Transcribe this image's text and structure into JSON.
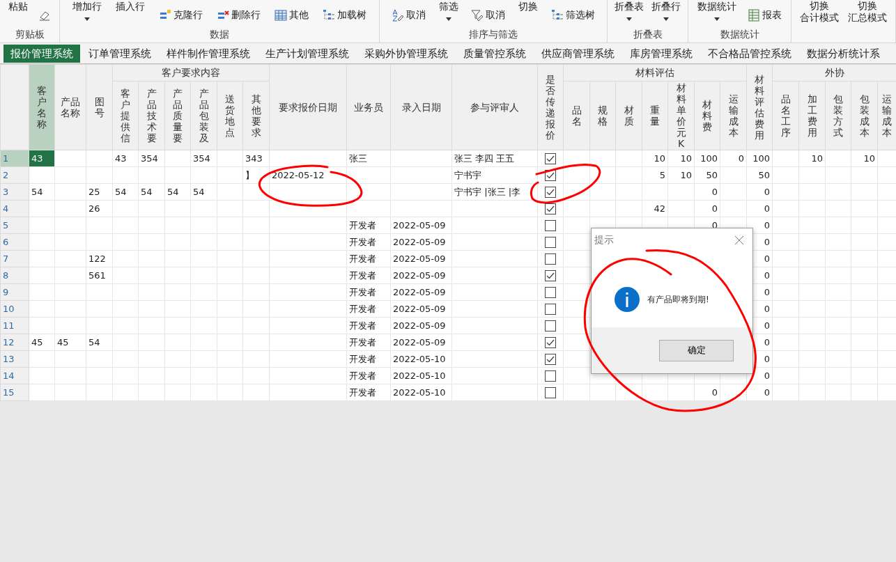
{
  "ribbon": {
    "groups": [
      {
        "label": "剪贴板",
        "items": [
          {
            "kind": "large",
            "label": "粘贴",
            "caret": false
          },
          {
            "kind": "icon"
          }
        ]
      },
      {
        "label": "数据",
        "items": [
          {
            "kind": "large",
            "label": "增加行",
            "caret": true
          },
          {
            "kind": "large",
            "label": "插入行",
            "caret": false
          },
          {
            "kind": "small",
            "label": "克隆行"
          },
          {
            "kind": "small",
            "label": "删除行"
          },
          {
            "kind": "small",
            "label": "其他"
          },
          {
            "kind": "small",
            "label": "加载树"
          }
        ]
      },
      {
        "label": "排序与筛选",
        "items": [
          {
            "kind": "small",
            "label": "取消"
          },
          {
            "kind": "large",
            "label": "筛选",
            "caret": true
          },
          {
            "kind": "small",
            "label": "取消"
          },
          {
            "kind": "large",
            "label": "切换",
            "caret": false
          },
          {
            "kind": "small",
            "label": "筛选树"
          }
        ]
      },
      {
        "label": "折叠表",
        "items": [
          {
            "kind": "large",
            "label": "折叠表",
            "caret": true
          },
          {
            "kind": "large",
            "label": "折叠行",
            "caret": true
          }
        ]
      },
      {
        "label": "数据统计",
        "items": [
          {
            "kind": "large",
            "label": "数据统计",
            "caret": true
          },
          {
            "kind": "small",
            "label": "报表"
          }
        ]
      },
      {
        "items": [
          {
            "kind": "stacked",
            "label": "切换",
            "caption": "合计模式"
          },
          {
            "kind": "stacked",
            "label": "切换",
            "caption": "汇总模式"
          }
        ]
      }
    ]
  },
  "tabs": [
    {
      "label": "报价管理系统",
      "selected": true
    },
    {
      "label": "订单管理系统",
      "selected": false
    },
    {
      "label": "样件制作管理系统",
      "selected": false
    },
    {
      "label": "生产计划管理系统",
      "selected": false
    },
    {
      "label": "采购外协管理系统",
      "selected": false
    },
    {
      "label": "质量管控系统",
      "selected": false
    },
    {
      "label": "供应商管理系统",
      "selected": false
    },
    {
      "label": "库房管理系统",
      "selected": false
    },
    {
      "label": "不合格品管控系统",
      "selected": false
    },
    {
      "label": "数据分析统计系",
      "selected": false
    }
  ],
  "table": {
    "header": [
      {
        "label": "客户名称",
        "kind": "text",
        "selected": true
      },
      {
        "label": "产品名称",
        "kind": "text",
        "selected": false
      },
      {
        "label": "图号",
        "kind": "text",
        "selected": false
      },
      {
        "label": "客户要求内容",
        "children": [
          {
            "label": "客户提供信",
            "kind": "text",
            "selected": false
          },
          {
            "label": "产品技术要",
            "kind": "text",
            "selected": false
          },
          {
            "label": "产品质量要",
            "kind": "text",
            "selected": false
          },
          {
            "label": "产品包装及",
            "kind": "text",
            "selected": false
          },
          {
            "label": "送货地点",
            "kind": "text",
            "selected": false
          },
          {
            "label": "其他要求",
            "kind": "text",
            "selected": false
          }
        ]
      },
      {
        "label": "要求报价日期",
        "kind": "text",
        "selected": false
      },
      {
        "label": "业务员",
        "kind": "text",
        "selected": false
      },
      {
        "label": "录入日期",
        "kind": "text",
        "selected": false
      },
      {
        "label": "参与评审人",
        "kind": "text",
        "selected": false
      },
      {
        "label": "是否传递报价",
        "kind": "check",
        "selected": false
      },
      {
        "label": "材料评估",
        "children": [
          {
            "label": "品名",
            "kind": "text",
            "selected": false
          },
          {
            "label": "规格",
            "kind": "text",
            "selected": false
          },
          {
            "label": "材质",
            "kind": "text",
            "selected": false
          },
          {
            "label": "重量",
            "kind": "text",
            "selected": false
          },
          {
            "label": "材料单价元K",
            "kind": "text",
            "selected": false
          },
          {
            "label": "材料费",
            "kind": "text",
            "selected": false
          },
          {
            "label": "运输成本",
            "kind": "text",
            "selected": false
          }
        ]
      },
      {
        "label": "材料评估费用",
        "kind": "text",
        "selected": false
      },
      {
        "label": "外协",
        "children": [
          {
            "label": "品名工序",
            "kind": "text",
            "selected": false
          },
          {
            "label": "加工费用",
            "kind": "text",
            "selected": false
          },
          {
            "label": "包装方式",
            "kind": "text",
            "selected": false
          },
          {
            "label": "包装成本",
            "kind": "text",
            "selected": false
          },
          {
            "label": "运输成本",
            "kind": "text",
            "selected": false
          }
        ]
      }
    ],
    "rows": [
      {
        "number": "1",
        "selected": true,
        "quote_sent": true,
        "cells": [
          "43",
          "",
          "",
          "43",
          "354",
          "",
          "354",
          "",
          "343",
          "",
          "张三",
          "",
          "张三  李四  王五",
          "",
          "",
          "",
          "10",
          "10",
          "100",
          "0",
          "100",
          "",
          "10",
          "",
          "10",
          ""
        ]
      },
      {
        "number": "2",
        "selected": false,
        "quote_sent": true,
        "cells": [
          "",
          "",
          "",
          "",
          "",
          "",
          "",
          "",
          "】",
          "2022-05-12",
          "",
          "",
          "宁书宇",
          "",
          "",
          "",
          "5",
          "10",
          "50",
          "",
          "50",
          "",
          "",
          "",
          "",
          ""
        ]
      },
      {
        "number": "3",
        "selected": false,
        "quote_sent": true,
        "cells": [
          "54",
          "",
          "25",
          "54",
          "54",
          "54",
          "54",
          "",
          "",
          "",
          "",
          "",
          "宁书宇 |张三 |李",
          "",
          "",
          "",
          "",
          "",
          "0",
          "",
          "0",
          "",
          "",
          "",
          "",
          ""
        ]
      },
      {
        "number": "4",
        "selected": false,
        "quote_sent": true,
        "cells": [
          "",
          "",
          "26",
          "",
          "",
          "",
          "",
          "",
          "",
          "",
          "",
          "",
          "",
          "",
          "",
          "",
          "42",
          "",
          "0",
          "",
          "0",
          "",
          "",
          "",
          "",
          ""
        ]
      },
      {
        "number": "5",
        "selected": false,
        "quote_sent": false,
        "cells": [
          "",
          "",
          "",
          "",
          "",
          "",
          "",
          "",
          "",
          "",
          "开发者",
          "2022-05-09",
          "",
          "",
          "",
          "",
          "",
          "",
          "0",
          "",
          "0",
          "",
          "",
          "",
          "",
          ""
        ]
      },
      {
        "number": "6",
        "selected": false,
        "quote_sent": false,
        "cells": [
          "",
          "",
          "",
          "",
          "",
          "",
          "",
          "",
          "",
          "",
          "开发者",
          "2022-05-09",
          "",
          "",
          "",
          "",
          "",
          "",
          "",
          "",
          "0",
          "",
          "",
          "",
          "",
          ""
        ]
      },
      {
        "number": "7",
        "selected": false,
        "quote_sent": false,
        "cells": [
          "",
          "",
          "122",
          "",
          "",
          "",
          "",
          "",
          "",
          "",
          "开发者",
          "2022-05-09",
          "",
          "",
          "",
          "",
          "",
          "",
          "",
          "",
          "0",
          "",
          "",
          "",
          "",
          ""
        ]
      },
      {
        "number": "8",
        "selected": false,
        "quote_sent": true,
        "cells": [
          "",
          "",
          "561",
          "",
          "",
          "",
          "",
          "",
          "",
          "",
          "开发者",
          "2022-05-09",
          "",
          "",
          "",
          "",
          "",
          "",
          "",
          "",
          "0",
          "",
          "",
          "",
          "",
          ""
        ]
      },
      {
        "number": "9",
        "selected": false,
        "quote_sent": false,
        "cells": [
          "",
          "",
          "",
          "",
          "",
          "",
          "",
          "",
          "",
          "",
          "开发者",
          "2022-05-09",
          "",
          "",
          "",
          "",
          "",
          "",
          "",
          "",
          "0",
          "",
          "",
          "",
          "",
          ""
        ]
      },
      {
        "number": "10",
        "selected": false,
        "quote_sent": false,
        "cells": [
          "",
          "",
          "",
          "",
          "",
          "",
          "",
          "",
          "",
          "",
          "开发者",
          "2022-05-09",
          "",
          "",
          "",
          "",
          "",
          "",
          "",
          "",
          "0",
          "",
          "",
          "",
          "",
          ""
        ]
      },
      {
        "number": "11",
        "selected": false,
        "quote_sent": false,
        "cells": [
          "",
          "",
          "",
          "",
          "",
          "",
          "",
          "",
          "",
          "",
          "开发者",
          "2022-05-09",
          "",
          "",
          "",
          "",
          "",
          "",
          "",
          "",
          "0",
          "",
          "",
          "",
          "",
          ""
        ]
      },
      {
        "number": "12",
        "selected": false,
        "quote_sent": true,
        "cells": [
          "45",
          "45",
          "54",
          "",
          "",
          "",
          "",
          "",
          "",
          "",
          "开发者",
          "2022-05-09",
          "",
          "",
          "",
          "",
          "",
          "",
          "",
          "",
          "0",
          "",
          "",
          "",
          "",
          ""
        ]
      },
      {
        "number": "13",
        "selected": false,
        "quote_sent": true,
        "cells": [
          "",
          "",
          "",
          "",
          "",
          "",
          "",
          "",
          "",
          "",
          "开发者",
          "2022-05-10",
          "",
          "",
          "",
          "",
          "",
          "",
          "",
          "",
          "0",
          "",
          "",
          "",
          "",
          ""
        ]
      },
      {
        "number": "14",
        "selected": false,
        "quote_sent": false,
        "cells": [
          "",
          "",
          "",
          "",
          "",
          "",
          "",
          "",
          "",
          "",
          "开发者",
          "2022-05-10",
          "",
          "",
          "",
          "",
          "",
          "",
          "",
          "",
          "0",
          "",
          "",
          "",
          "",
          ""
        ]
      },
      {
        "number": "15",
        "selected": false,
        "quote_sent": false,
        "cells": [
          "",
          "",
          "",
          "",
          "",
          "",
          "",
          "",
          "",
          "",
          "开发者",
          "2022-05-10",
          "",
          "",
          "",
          "",
          "",
          "",
          "0",
          "",
          "0",
          "",
          "",
          "",
          "",
          ""
        ]
      }
    ]
  },
  "dialog": {
    "title": "提示",
    "message": "有产品即将到期!",
    "button": "确定"
  }
}
